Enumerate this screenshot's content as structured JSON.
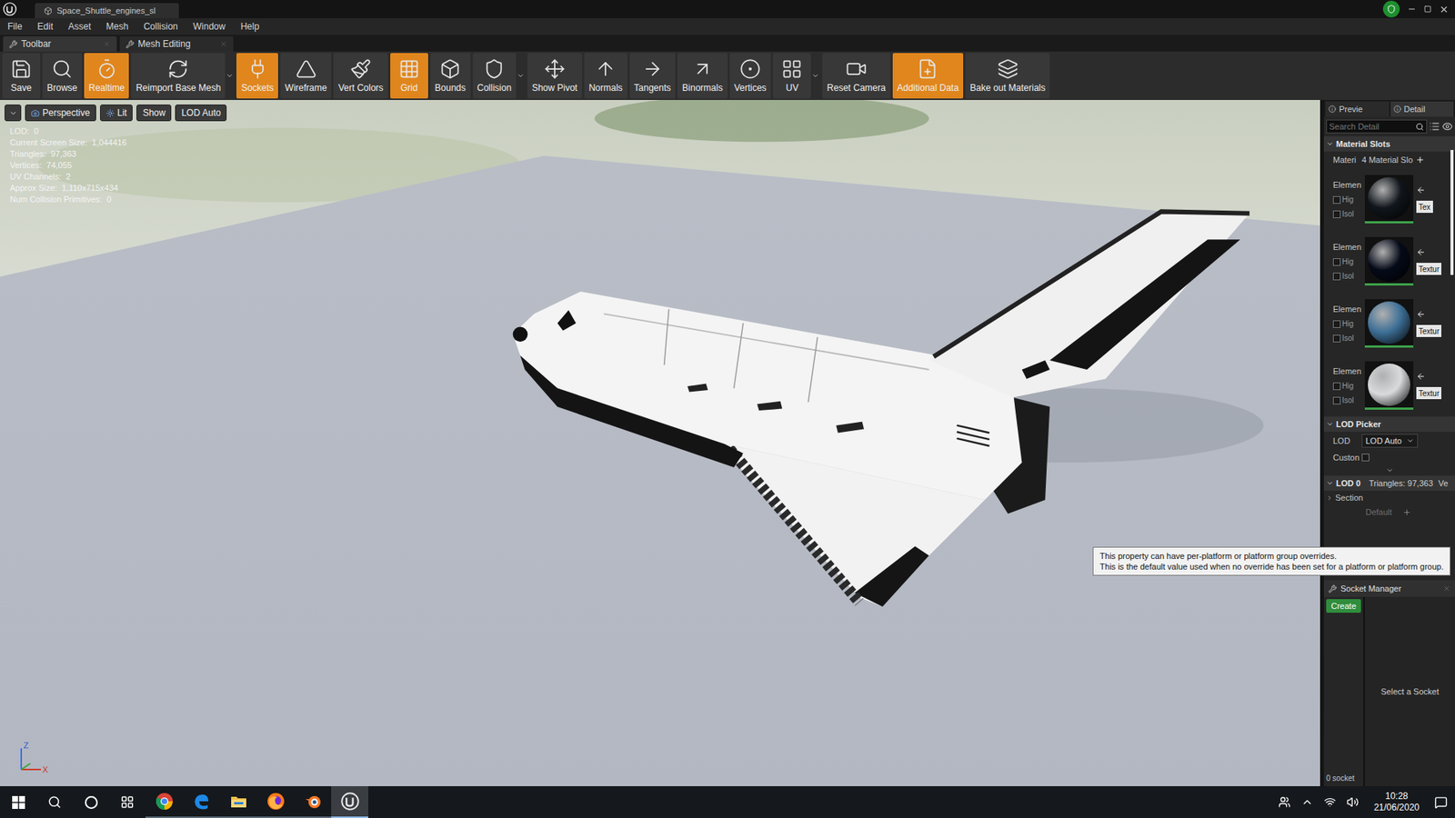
{
  "window": {
    "title": "Space_Shuttle_engines_sl"
  },
  "menu": [
    "File",
    "Edit",
    "Asset",
    "Mesh",
    "Collision",
    "Window",
    "Help"
  ],
  "panel_tabs": [
    {
      "label": "Toolbar",
      "selected": true
    },
    {
      "label": "Mesh Editing",
      "selected": false
    }
  ],
  "toolbar": [
    {
      "label": "Save",
      "active": false,
      "dropdown": false
    },
    {
      "label": "Browse",
      "active": false,
      "dropdown": false
    },
    {
      "label": "Realtime",
      "active": true,
      "dropdown": false
    },
    {
      "label": "Reimport Base Mesh",
      "active": false,
      "dropdown": true
    },
    {
      "label": "Sockets",
      "active": true,
      "dropdown": false
    },
    {
      "label": "Wireframe",
      "active": false,
      "dropdown": false
    },
    {
      "label": "Vert Colors",
      "active": false,
      "dropdown": false
    },
    {
      "label": "Grid",
      "active": true,
      "dropdown": false
    },
    {
      "label": "Bounds",
      "active": false,
      "dropdown": false
    },
    {
      "label": "Collision",
      "active": false,
      "dropdown": true
    },
    {
      "label": "Show Pivot",
      "active": false,
      "dropdown": false
    },
    {
      "label": "Normals",
      "active": false,
      "dropdown": false
    },
    {
      "label": "Tangents",
      "active": false,
      "dropdown": false
    },
    {
      "label": "Binormals",
      "active": false,
      "dropdown": false
    },
    {
      "label": "Vertices",
      "active": false,
      "dropdown": false
    },
    {
      "label": "UV",
      "active": false,
      "dropdown": true
    },
    {
      "label": "Reset Camera",
      "active": false,
      "dropdown": false
    },
    {
      "label": "Additional Data",
      "active": true,
      "dropdown": false
    },
    {
      "label": "Bake out Materials",
      "active": false,
      "dropdown": false
    }
  ],
  "viewport": {
    "buttons": [
      "Perspective",
      "Lit",
      "Show",
      "LOD Auto"
    ],
    "stats": [
      "LOD:  0",
      "Current Screen Size:  1,044416",
      "Triangles:  97,363",
      "Vertices:  74,055",
      "UV Channels:  2",
      "Approx Size:  1,110x715x434",
      "Num Collision Primitives:  0"
    ],
    "axes": [
      "Z",
      "X"
    ]
  },
  "details": {
    "tabs": [
      {
        "label": "Previe",
        "selected": false
      },
      {
        "label": "Detail",
        "selected": true
      }
    ],
    "search_placeholder": "Search Detail",
    "material_slots": {
      "header": "Material Slots",
      "label": "Materi",
      "count": "4 Material Slo",
      "elements": [
        {
          "label": "Elemen",
          "highlight": "Hig",
          "isolate": "Isol",
          "highlight_checked": false,
          "isolate_checked": false,
          "button": "Tex",
          "color": "#10161c"
        },
        {
          "label": "Elemen",
          "highlight": "Hig",
          "isolate": "Isol",
          "highlight_checked": false,
          "isolate_checked": false,
          "button": "Textur",
          "color": "#050a18"
        },
        {
          "label": "Elemen",
          "highlight": "Hig",
          "isolate": "Isol",
          "highlight_checked": false,
          "isolate_checked": false,
          "button": "Textur",
          "color": "#3d6f96"
        },
        {
          "label": "Elemen",
          "highlight": "Hig",
          "isolate": "Isol",
          "highlight_checked": false,
          "isolate_checked": false,
          "button": "Textur",
          "color": "#d8dadc"
        }
      ]
    },
    "lod_picker": {
      "header": "LOD Picker",
      "lod_label": "LOD",
      "lod_value": "LOD Auto",
      "custom_label": "Custon",
      "custom_checked": false
    },
    "lod0": {
      "header": "LOD 0",
      "triangles": "Triangles: 97,363",
      "extra": "Ve",
      "section": "Section",
      "default": "Default"
    }
  },
  "tooltip": [
    "This property can have per-platform or platform group overrides.",
    "This is the default value used when no override has been set for a platform or platform group."
  ],
  "socket_manager": {
    "header": "Socket Manager",
    "create": "Create",
    "empty": "Select a Socket",
    "count": "0 socket"
  },
  "taskbar": {
    "apps": [
      {
        "kind": "chrome",
        "active": false
      },
      {
        "kind": "edge",
        "active": false
      },
      {
        "kind": "explorer",
        "active": false
      },
      {
        "kind": "firefox",
        "active": false
      },
      {
        "kind": "blender",
        "active": false
      },
      {
        "kind": "unreal",
        "active": true
      }
    ],
    "time": "10:28",
    "date": "21/06/2020"
  }
}
